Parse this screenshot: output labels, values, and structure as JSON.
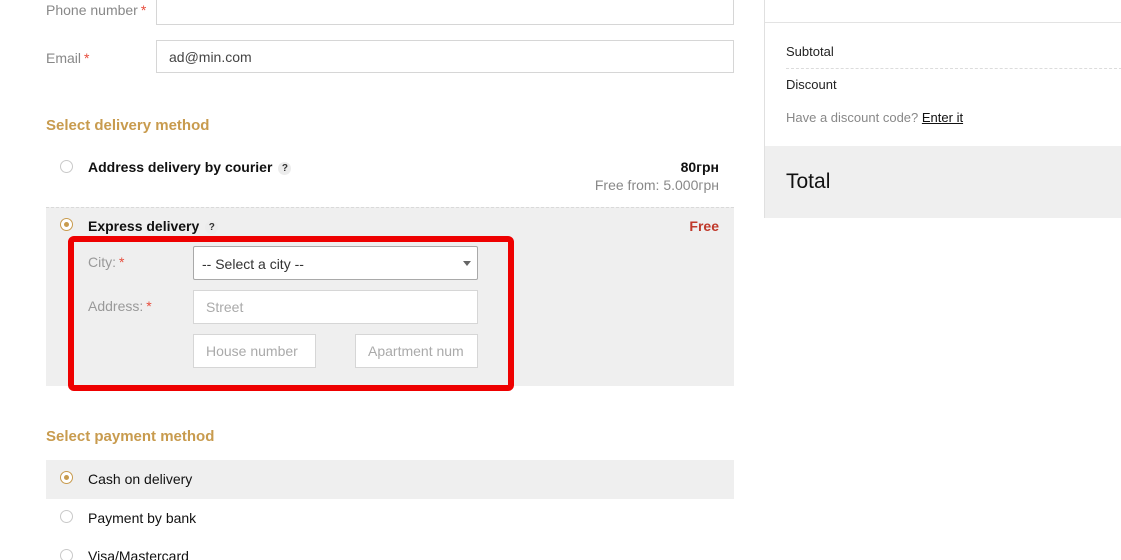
{
  "contact": {
    "phone_label": "Phone number",
    "phone_value": "",
    "email_label": "Email",
    "email_value": "ad@min.com",
    "required_mark": "*"
  },
  "delivery": {
    "title": "Select delivery method",
    "courier": {
      "label": "Address delivery by courier",
      "help": "?",
      "price": "80грн",
      "free_from": "Free from: 5.000грн"
    },
    "express": {
      "label": "Express delivery",
      "help": "?",
      "price": "Free",
      "city_label": "City:",
      "city_select": "-- Select a city --",
      "address_label": "Address:",
      "street_placeholder": "Street",
      "house_placeholder": "House number",
      "apartment_placeholder": "Apartment num"
    }
  },
  "payment": {
    "title": "Select payment method",
    "options": [
      {
        "label": "Cash on delivery"
      },
      {
        "label": "Payment by bank"
      },
      {
        "label": "Visa/Mastercard"
      }
    ]
  },
  "summary": {
    "subtotal_label": "Subtotal",
    "discount_label": "Discount",
    "discount_prompt": "Have a discount code?",
    "discount_link": "Enter it",
    "total_label": "Total"
  },
  "colors": {
    "accent": "#c89b4e",
    "required": "#e74c3c",
    "free_price": "#c0392b",
    "highlight": "#ee0000",
    "panel_bg": "#efefef"
  }
}
